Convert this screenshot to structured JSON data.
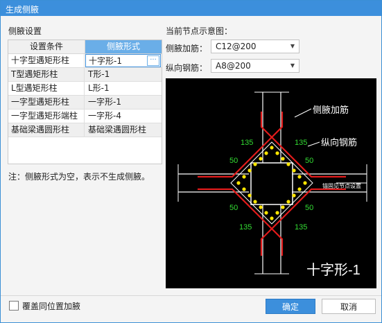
{
  "window": {
    "title": "生成侧腋"
  },
  "left": {
    "section_label": "侧腋设置",
    "columns": [
      "设置条件",
      "侧腋形式"
    ],
    "rows": [
      {
        "cond": "十字型遇矩形柱",
        "form": "十字形-1"
      },
      {
        "cond": "T型遇矩形柱",
        "form": "T形-1"
      },
      {
        "cond": "L型遇矩形柱",
        "form": "L形-1"
      },
      {
        "cond": "一字型遇矩形柱",
        "form": "一字形-1"
      },
      {
        "cond": "一字型遇矩形端柱",
        "form": "一字形-4"
      },
      {
        "cond": "基础梁遇圆形柱",
        "form": "基础梁遇圆形柱"
      }
    ],
    "note": "注：侧腋形式为空，表示不生成侧腋。"
  },
  "right": {
    "preview_label": "当前节点示意图：",
    "side_rebar": {
      "label": "侧腋加筋：",
      "value": "C12@200"
    },
    "long_rebar": {
      "label": "纵向钢筋：",
      "value": "A8@200"
    },
    "diagram": {
      "callout_side": "侧腋加筋",
      "callout_long": "纵向钢筋",
      "dims": [
        "135",
        "135",
        "50",
        "50",
        "50",
        "50",
        "135",
        "135"
      ],
      "anchor_note": "锚固见节点设置",
      "caption": "十字形-1"
    }
  },
  "footer": {
    "checkbox_label": "覆盖同位置加腋",
    "ok": "确定",
    "cancel": "取消"
  }
}
